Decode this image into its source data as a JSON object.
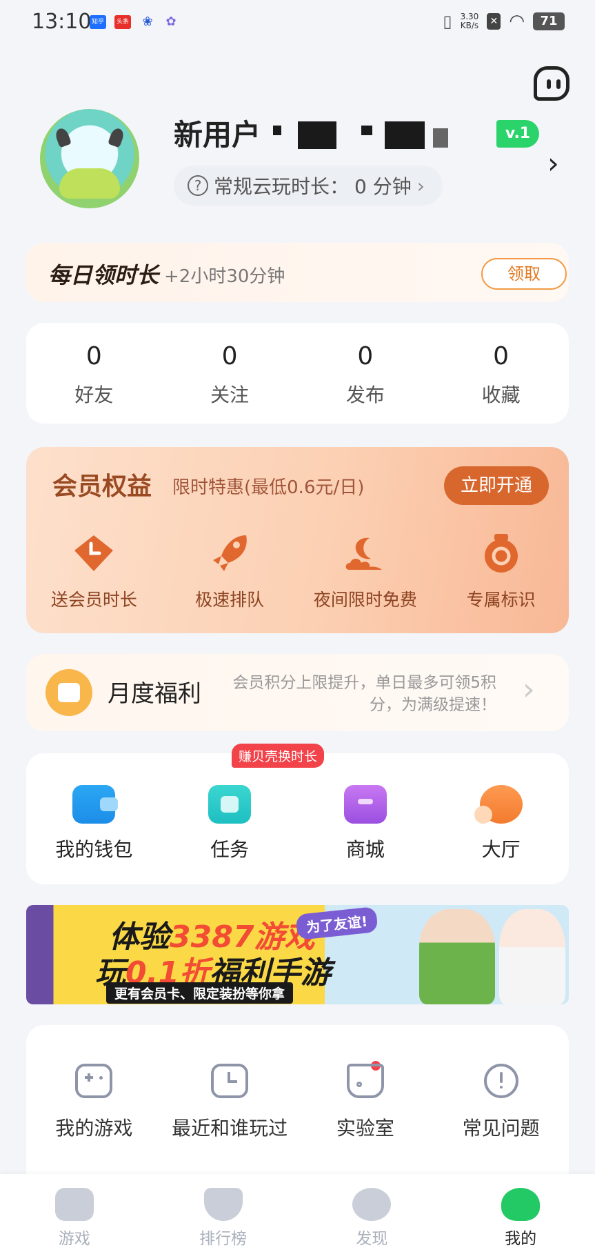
{
  "status_bar": {
    "time": "13:10",
    "apps": [
      "知乎",
      "头条"
    ],
    "net_speed": "3.30",
    "net_unit": "KB/s",
    "battery": "71"
  },
  "profile": {
    "username": "新用户",
    "level_badge": "v.1",
    "cloud_time_label": "常规云玩时长：",
    "cloud_time_value": "0 分钟"
  },
  "daily": {
    "title": "每日领时长",
    "subtitle": "+2小时30分钟",
    "button": "领取"
  },
  "stats": [
    {
      "value": "0",
      "label": "好友"
    },
    {
      "value": "0",
      "label": "关注"
    },
    {
      "value": "0",
      "label": "发布"
    },
    {
      "value": "0",
      "label": "收藏"
    }
  ],
  "vip": {
    "title": "会员权益",
    "subtitle": "限时特惠(最低0.6元/日)",
    "button": "立即开通",
    "items": [
      {
        "icon": "clock-diamond-icon",
        "label": "送会员时长"
      },
      {
        "icon": "rocket-icon",
        "label": "极速排队"
      },
      {
        "icon": "moon-cloud-icon",
        "label": "夜间限时免费"
      },
      {
        "icon": "medal-icon",
        "label": "专属标识"
      }
    ],
    "accent": "#d8672e"
  },
  "monthly": {
    "title": "月度福利",
    "desc": "会员积分上限提升，单日最多可领5积分，为满级提速！"
  },
  "quick": {
    "task_badge": "赚贝壳换时长",
    "items": [
      {
        "icon": "wallet-icon",
        "label": "我的钱包"
      },
      {
        "icon": "task-icon",
        "label": "任务"
      },
      {
        "icon": "shop-icon",
        "label": "商城"
      },
      {
        "icon": "hall-icon",
        "label": "大厅"
      }
    ]
  },
  "banner": {
    "line1_a": "体验",
    "line1_b": "3387游戏",
    "line2_a": "玩",
    "line2_b": "0.1折",
    "line2_c": "福利手游",
    "line3": "更有会员卡、限定装扮等你拿",
    "tag": "为了友谊!"
  },
  "tools": [
    {
      "icon": "gamepad-icon",
      "label": "我的游戏"
    },
    {
      "icon": "recent-clock-icon",
      "label": "最近和谁玩过"
    },
    {
      "icon": "flask-icon",
      "label": "实验室"
    },
    {
      "icon": "info-icon",
      "label": "常见问题"
    }
  ],
  "bottom_nav": [
    {
      "icon": "games-nav-icon",
      "label": "游戏"
    },
    {
      "icon": "ranking-nav-icon",
      "label": "排行榜"
    },
    {
      "icon": "discover-nav-icon",
      "label": "发现"
    },
    {
      "icon": "mine-nav-icon",
      "label": "我的",
      "active": true
    }
  ]
}
